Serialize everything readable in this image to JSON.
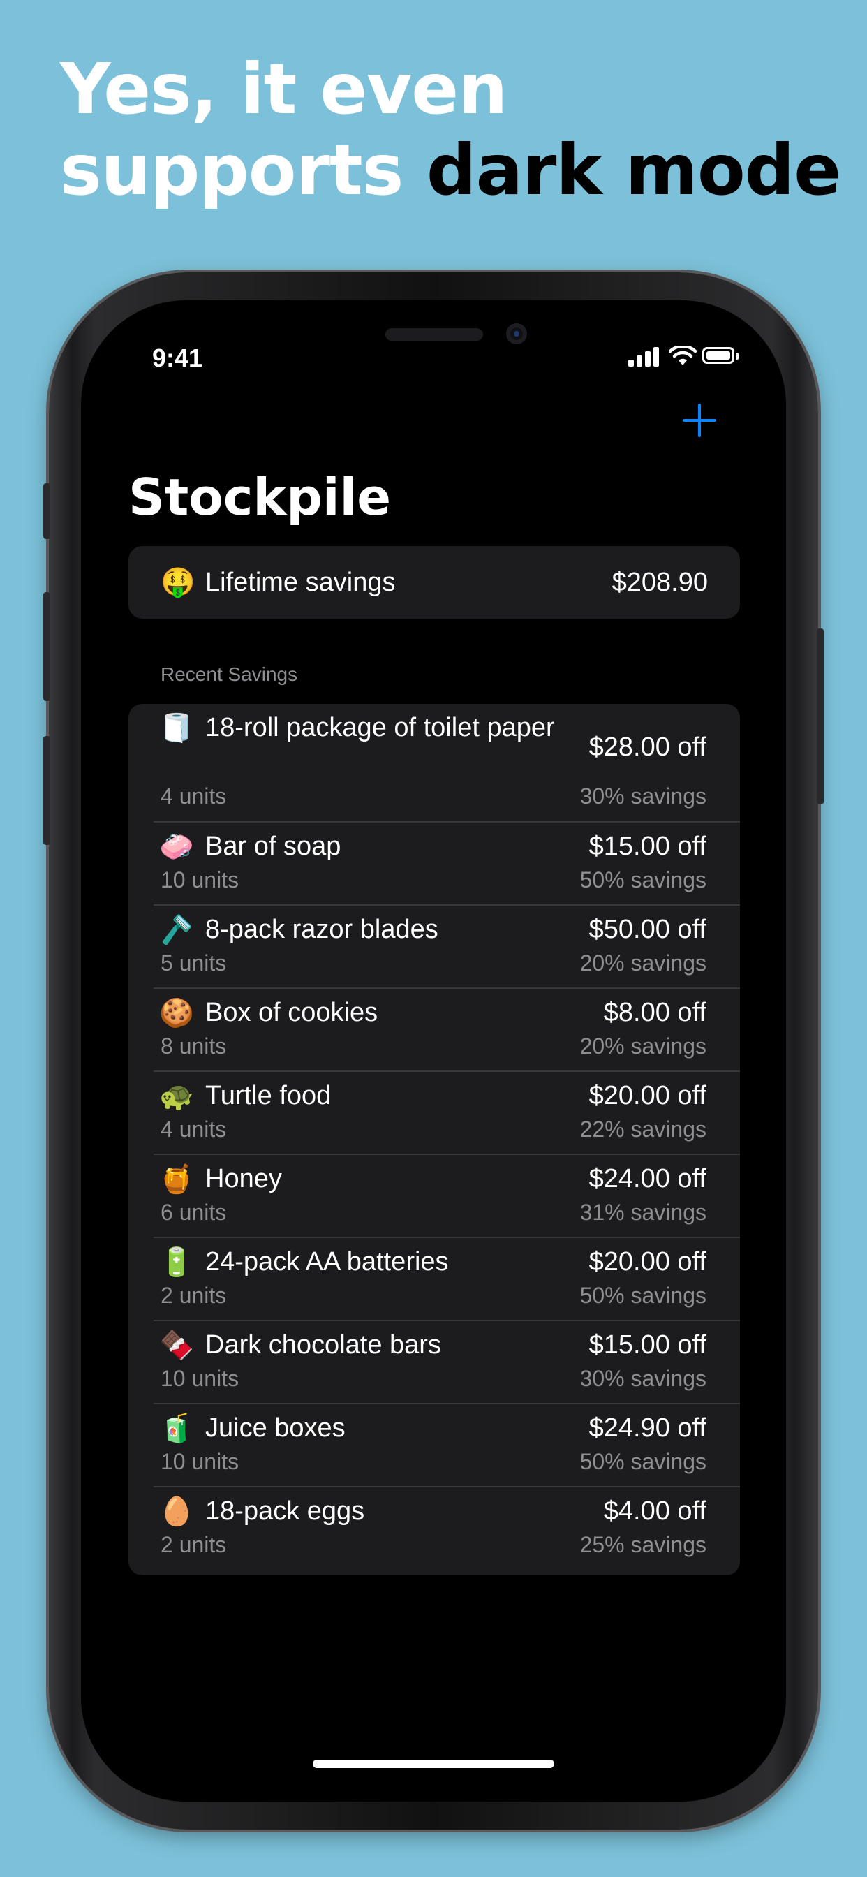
{
  "headline": {
    "line1": "Yes, it even",
    "line2_light": "supports",
    "line2_dark": "dark mode"
  },
  "status_bar": {
    "time": "9:41",
    "signal_icon": "signal-icon",
    "wifi_icon": "wifi-icon",
    "battery_icon": "battery-icon"
  },
  "nav": {
    "add_icon": "plus-icon",
    "accent_color": "#0a84ff",
    "title": "Stockpile"
  },
  "lifetime": {
    "emoji": "🤑",
    "label": "Lifetime savings",
    "value": "$208.90"
  },
  "section_header": "Recent Savings",
  "items": [
    {
      "emoji": "🧻",
      "name": "18-roll package of toilet paper",
      "units": "4 units",
      "off": "$28.00 off",
      "savings": "30% savings"
    },
    {
      "emoji": "🧼",
      "name": "Bar of soap",
      "units": "10 units",
      "off": "$15.00 off",
      "savings": "50% savings"
    },
    {
      "emoji": "🪒",
      "name": "8-pack razor blades",
      "units": "5 units",
      "off": "$50.00 off",
      "savings": "20% savings"
    },
    {
      "emoji": "🍪",
      "name": "Box of cookies",
      "units": "8 units",
      "off": "$8.00 off",
      "savings": "20% savings"
    },
    {
      "emoji": "🐢",
      "name": "Turtle food",
      "units": "4 units",
      "off": "$20.00 off",
      "savings": "22% savings"
    },
    {
      "emoji": "🍯",
      "name": "Honey",
      "units": "6 units",
      "off": "$24.00 off",
      "savings": "31% savings"
    },
    {
      "emoji": "🔋",
      "name": "24-pack AA batteries",
      "units": "2 units",
      "off": "$20.00 off",
      "savings": "50% savings"
    },
    {
      "emoji": "🍫",
      "name": "Dark chocolate bars",
      "units": "10 units",
      "off": "$15.00 off",
      "savings": "30% savings"
    },
    {
      "emoji": "🧃",
      "name": "Juice boxes",
      "units": "10 units",
      "off": "$24.90 off",
      "savings": "50% savings"
    },
    {
      "emoji": "🥚",
      "name": "18-pack eggs",
      "units": "2 units",
      "off": "$4.00 off",
      "savings": "25% savings"
    }
  ]
}
